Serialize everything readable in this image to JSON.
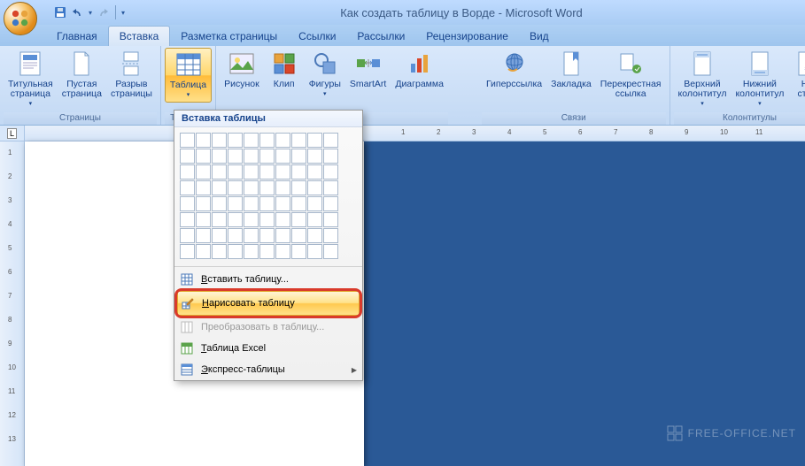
{
  "title": "Как создать таблицу в Ворде - Microsoft Word",
  "tabs": {
    "home": "Главная",
    "insert": "Вставка",
    "layout": "Разметка страницы",
    "refs": "Ссылки",
    "mail": "Рассылки",
    "review": "Рецензирование",
    "view": "Вид"
  },
  "groups": {
    "pages": {
      "label": "Страницы",
      "items": {
        "cover": "Титульная\nстраница",
        "blank": "Пустая\nстраница",
        "break": "Разрыв\nстраницы"
      }
    },
    "tables": {
      "label": "Таблицы",
      "items": {
        "table": "Таблица"
      }
    },
    "illus": {
      "label": "",
      "items": {
        "pic": "Рисунок",
        "clip": "Клип",
        "shapes": "Фигуры",
        "smart": "SmartArt",
        "chart": "Диаграмма"
      }
    },
    "links": {
      "label": "Связи",
      "items": {
        "hyper": "Гиперссылка",
        "bookmark": "Закладка",
        "cross": "Перекрестная\nссылка"
      }
    },
    "header": {
      "label": "Колонтитулы",
      "items": {
        "head": "Верхний\nколонтитул",
        "foot": "Нижний\nколонтитул",
        "num": "Но\nстра"
      }
    }
  },
  "menu": {
    "title": "Вставка таблицы",
    "insert": "Вставить таблицу...",
    "draw": "Нарисовать таблицу",
    "convert": "Преобразовать в таблицу...",
    "excel": "Таблица Excel",
    "quick": "Экспресс-таблицы"
  },
  "ruler_nums": [
    "1",
    "1",
    "2",
    "3",
    "4",
    "5",
    "6",
    "7",
    "8",
    "9",
    "10",
    "11"
  ],
  "vruler_nums": [
    "1",
    "2",
    "3",
    "4",
    "5",
    "6",
    "7",
    "8",
    "9",
    "10",
    "11",
    "12",
    "13"
  ],
  "watermark": "FREE-OFFICE.NET"
}
